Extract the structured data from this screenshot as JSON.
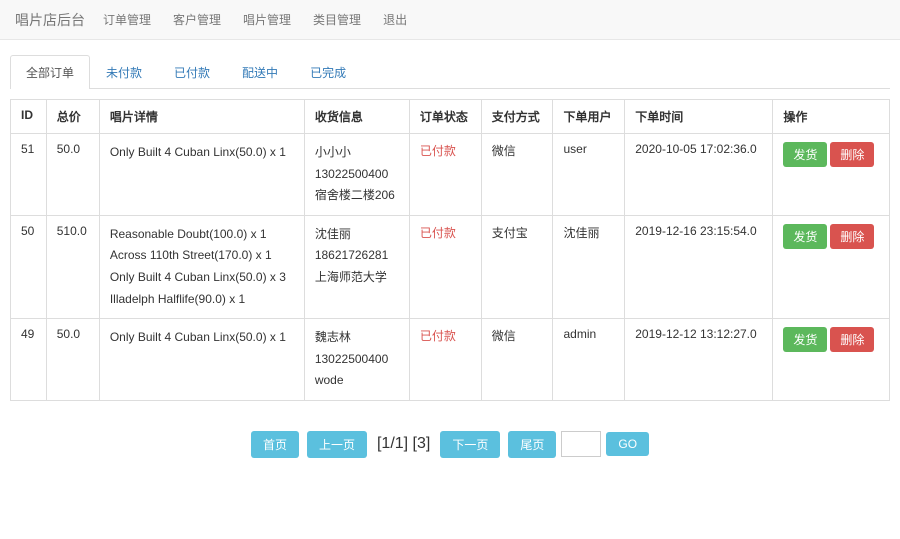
{
  "navbar": {
    "brand": "唱片店后台",
    "items": [
      "订单管理",
      "客户管理",
      "唱片管理",
      "类目管理",
      "退出"
    ]
  },
  "tabs": {
    "items": [
      "全部订单",
      "未付款",
      "已付款",
      "配送中",
      "已完成"
    ],
    "active": 0
  },
  "table": {
    "headers": [
      "ID",
      "总价",
      "唱片详情",
      "收货信息",
      "订单状态",
      "支付方式",
      "下单用户",
      "下单时间",
      "操作"
    ],
    "rows": [
      {
        "id": "51",
        "total": "50.0",
        "details": [
          "Only Built 4 Cuban Linx(50.0) x 1"
        ],
        "shipping": [
          "小小小",
          "13022500400",
          "宿舍楼二楼206"
        ],
        "status": "已付款",
        "payment": "微信",
        "user": "user",
        "time": "2020-10-05 17:02:36.0"
      },
      {
        "id": "50",
        "total": "510.0",
        "details": [
          "Reasonable Doubt(100.0) x 1",
          "Across 110th Street(170.0) x 1",
          "Only Built 4 Cuban Linx(50.0) x 3",
          "Illadelph Halflife(90.0) x 1"
        ],
        "shipping": [
          "沈佳丽",
          "18621726281",
          "上海师范大学"
        ],
        "status": "已付款",
        "payment": "支付宝",
        "user": "沈佳丽",
        "time": "2019-12-16 23:15:54.0"
      },
      {
        "id": "49",
        "total": "50.0",
        "details": [
          "Only Built 4 Cuban Linx(50.0) x 1"
        ],
        "shipping": [
          "魏志林",
          "13022500400",
          "wode"
        ],
        "status": "已付款",
        "payment": "微信",
        "user": "admin",
        "time": "2019-12-12 13:12:27.0"
      }
    ],
    "actions": {
      "ship": "发货",
      "delete": "删除"
    }
  },
  "pagination": {
    "first": "首页",
    "prev": "上一页",
    "info": "[1/1] [3]",
    "next": "下一页",
    "last": "尾页",
    "go": "GO"
  }
}
